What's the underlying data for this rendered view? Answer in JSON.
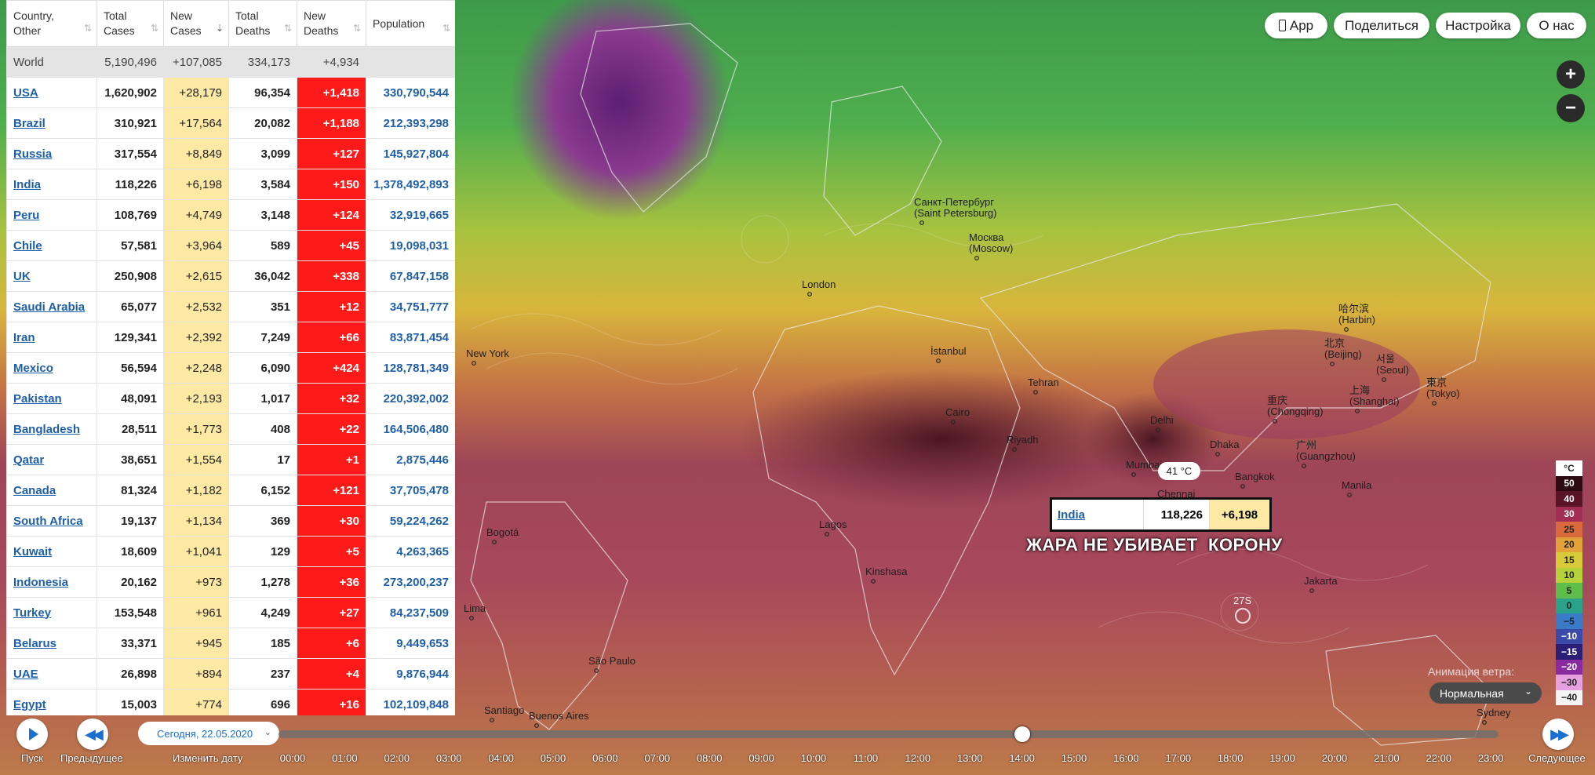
{
  "table": {
    "headers": [
      "Country,\nOther",
      "Total\nCases",
      "New\nCases",
      "Total\nDeaths",
      "New\nDeaths",
      "Population"
    ],
    "world": {
      "country": "World",
      "total": "5,190,496",
      "new_cases": "+107,085",
      "total_deaths": "334,173",
      "new_deaths": "+4,934",
      "population": ""
    },
    "rows": [
      {
        "country": "USA",
        "total": "1,620,902",
        "new_cases": "+28,179",
        "total_deaths": "96,354",
        "new_deaths": "+1,418",
        "population": "330,790,544"
      },
      {
        "country": "Brazil",
        "total": "310,921",
        "new_cases": "+17,564",
        "total_deaths": "20,082",
        "new_deaths": "+1,188",
        "population": "212,393,298"
      },
      {
        "country": "Russia",
        "total": "317,554",
        "new_cases": "+8,849",
        "total_deaths": "3,099",
        "new_deaths": "+127",
        "population": "145,927,804"
      },
      {
        "country": "India",
        "total": "118,226",
        "new_cases": "+6,198",
        "total_deaths": "3,584",
        "new_deaths": "+150",
        "population": "1,378,492,893"
      },
      {
        "country": "Peru",
        "total": "108,769",
        "new_cases": "+4,749",
        "total_deaths": "3,148",
        "new_deaths": "+124",
        "population": "32,919,665"
      },
      {
        "country": "Chile",
        "total": "57,581",
        "new_cases": "+3,964",
        "total_deaths": "589",
        "new_deaths": "+45",
        "population": "19,098,031"
      },
      {
        "country": "UK",
        "total": "250,908",
        "new_cases": "+2,615",
        "total_deaths": "36,042",
        "new_deaths": "+338",
        "population": "67,847,158"
      },
      {
        "country": "Saudi Arabia",
        "total": "65,077",
        "new_cases": "+2,532",
        "total_deaths": "351",
        "new_deaths": "+12",
        "population": "34,751,777"
      },
      {
        "country": "Iran",
        "total": "129,341",
        "new_cases": "+2,392",
        "total_deaths": "7,249",
        "new_deaths": "+66",
        "population": "83,871,454"
      },
      {
        "country": "Mexico",
        "total": "56,594",
        "new_cases": "+2,248",
        "total_deaths": "6,090",
        "new_deaths": "+424",
        "population": "128,781,349"
      },
      {
        "country": "Pakistan",
        "total": "48,091",
        "new_cases": "+2,193",
        "total_deaths": "1,017",
        "new_deaths": "+32",
        "population": "220,392,002"
      },
      {
        "country": "Bangladesh",
        "total": "28,511",
        "new_cases": "+1,773",
        "total_deaths": "408",
        "new_deaths": "+22",
        "population": "164,506,480"
      },
      {
        "country": "Qatar",
        "total": "38,651",
        "new_cases": "+1,554",
        "total_deaths": "17",
        "new_deaths": "+1",
        "population": "2,875,446"
      },
      {
        "country": "Canada",
        "total": "81,324",
        "new_cases": "+1,182",
        "total_deaths": "6,152",
        "new_deaths": "+121",
        "population": "37,705,478"
      },
      {
        "country": "South Africa",
        "total": "19,137",
        "new_cases": "+1,134",
        "total_deaths": "369",
        "new_deaths": "+30",
        "population": "59,224,262"
      },
      {
        "country": "Kuwait",
        "total": "18,609",
        "new_cases": "+1,041",
        "total_deaths": "129",
        "new_deaths": "+5",
        "population": "4,263,365"
      },
      {
        "country": "Indonesia",
        "total": "20,162",
        "new_cases": "+973",
        "total_deaths": "1,278",
        "new_deaths": "+36",
        "population": "273,200,237"
      },
      {
        "country": "Turkey",
        "total": "153,548",
        "new_cases": "+961",
        "total_deaths": "4,249",
        "new_deaths": "+27",
        "population": "84,237,509"
      },
      {
        "country": "Belarus",
        "total": "33,371",
        "new_cases": "+945",
        "total_deaths": "185",
        "new_deaths": "+6",
        "population": "9,449,653"
      },
      {
        "country": "UAE",
        "total": "26,898",
        "new_cases": "+894",
        "total_deaths": "237",
        "new_deaths": "+4",
        "population": "9,876,944"
      },
      {
        "country": "Egypt",
        "total": "15,003",
        "new_cases": "+774",
        "total_deaths": "696",
        "new_deaths": "+16",
        "population": "102,109,848"
      }
    ]
  },
  "top_buttons": {
    "app": "App",
    "share": "Поделиться",
    "settings": "Настройка",
    "about": "О нас"
  },
  "zoom": {
    "in": "+",
    "out": "−"
  },
  "legend": {
    "unit": "°C",
    "items": [
      {
        "label": "50",
        "color": "#2b0a12"
      },
      {
        "label": "40",
        "color": "#5a1428"
      },
      {
        "label": "30",
        "color": "#a22e55"
      },
      {
        "label": "25",
        "color": "#d86a3c"
      },
      {
        "label": "20",
        "color": "#e3a13a"
      },
      {
        "label": "15",
        "color": "#d8cb3a"
      },
      {
        "label": "10",
        "color": "#b5d23b"
      },
      {
        "label": "5",
        "color": "#5fbe4a"
      },
      {
        "label": "0",
        "color": "#2aa38a"
      },
      {
        "label": "−5",
        "color": "#3a7bc8"
      },
      {
        "label": "−10",
        "color": "#3a4aa8"
      },
      {
        "label": "−15",
        "color": "#2a1f74"
      },
      {
        "label": "−20",
        "color": "#8a2aa0"
      },
      {
        "label": "−30",
        "color": "#e6a0e0"
      },
      {
        "label": "−40",
        "color": "#f4f4f4"
      }
    ]
  },
  "wind": {
    "label": "Анимация ветра:",
    "value": "Нормальная"
  },
  "tooltip": {
    "country": "India",
    "total": "118,226",
    "new": "+6,198",
    "temp": "41 °C"
  },
  "headline": "ЖАРА НЕ УБИВАЕТ  КОРОНУ",
  "storm_label": "27S",
  "cities": [
    {
      "name": "Санкт-Петербург",
      "sub": "(Saint Petersburg)"
    },
    {
      "name": "Москва",
      "sub": "(Moscow)"
    },
    {
      "name": "London",
      "sub": ""
    },
    {
      "name": "New York",
      "sub": ""
    },
    {
      "name": "İstanbul",
      "sub": ""
    },
    {
      "name": "Cairo",
      "sub": ""
    },
    {
      "name": "Riyadh",
      "sub": ""
    },
    {
      "name": "Tehran",
      "sub": ""
    },
    {
      "name": "Delhi",
      "sub": ""
    },
    {
      "name": "Dhaka",
      "sub": ""
    },
    {
      "name": "Mumbai",
      "sub": ""
    },
    {
      "name": "Chennai",
      "sub": ""
    },
    {
      "name": "哈尔滨",
      "sub": "(Harbin)"
    },
    {
      "name": "北京",
      "sub": "(Beijing)"
    },
    {
      "name": "서울",
      "sub": "(Seoul)"
    },
    {
      "name": "東京",
      "sub": "(Tokyo)"
    },
    {
      "name": "上海",
      "sub": "(Shanghai)"
    },
    {
      "name": "重庆",
      "sub": "(Chongqing)"
    },
    {
      "name": "广州",
      "sub": "(Guangzhou)"
    },
    {
      "name": "Manila",
      "sub": ""
    },
    {
      "name": "Bangkok",
      "sub": ""
    },
    {
      "name": "Jakarta",
      "sub": ""
    },
    {
      "name": "Bogotá",
      "sub": ""
    },
    {
      "name": "Lagos",
      "sub": ""
    },
    {
      "name": "Kinshasa",
      "sub": ""
    },
    {
      "name": "Lima",
      "sub": ""
    },
    {
      "name": "São Paulo",
      "sub": ""
    },
    {
      "name": "Santiago",
      "sub": ""
    },
    {
      "name": "Buenos Aires",
      "sub": ""
    },
    {
      "name": "Sydney",
      "sub": ""
    }
  ],
  "timeline": {
    "play_label": "Пуск",
    "prev_label": "Предыдущее",
    "date_value": "Сегодня, 22.05.2020",
    "change_date_label": "Изменить дату",
    "next_label": "Следующее",
    "hours": [
      "00:00",
      "01:00",
      "02:00",
      "03:00",
      "04:00",
      "05:00",
      "06:00",
      "07:00",
      "08:00",
      "09:00",
      "10:00",
      "11:00",
      "12:00",
      "13:00",
      "14:00",
      "15:00",
      "16:00",
      "17:00",
      "18:00",
      "19:00",
      "20:00",
      "21:00",
      "22:00",
      "23:00"
    ],
    "current_hour": "14:00"
  }
}
